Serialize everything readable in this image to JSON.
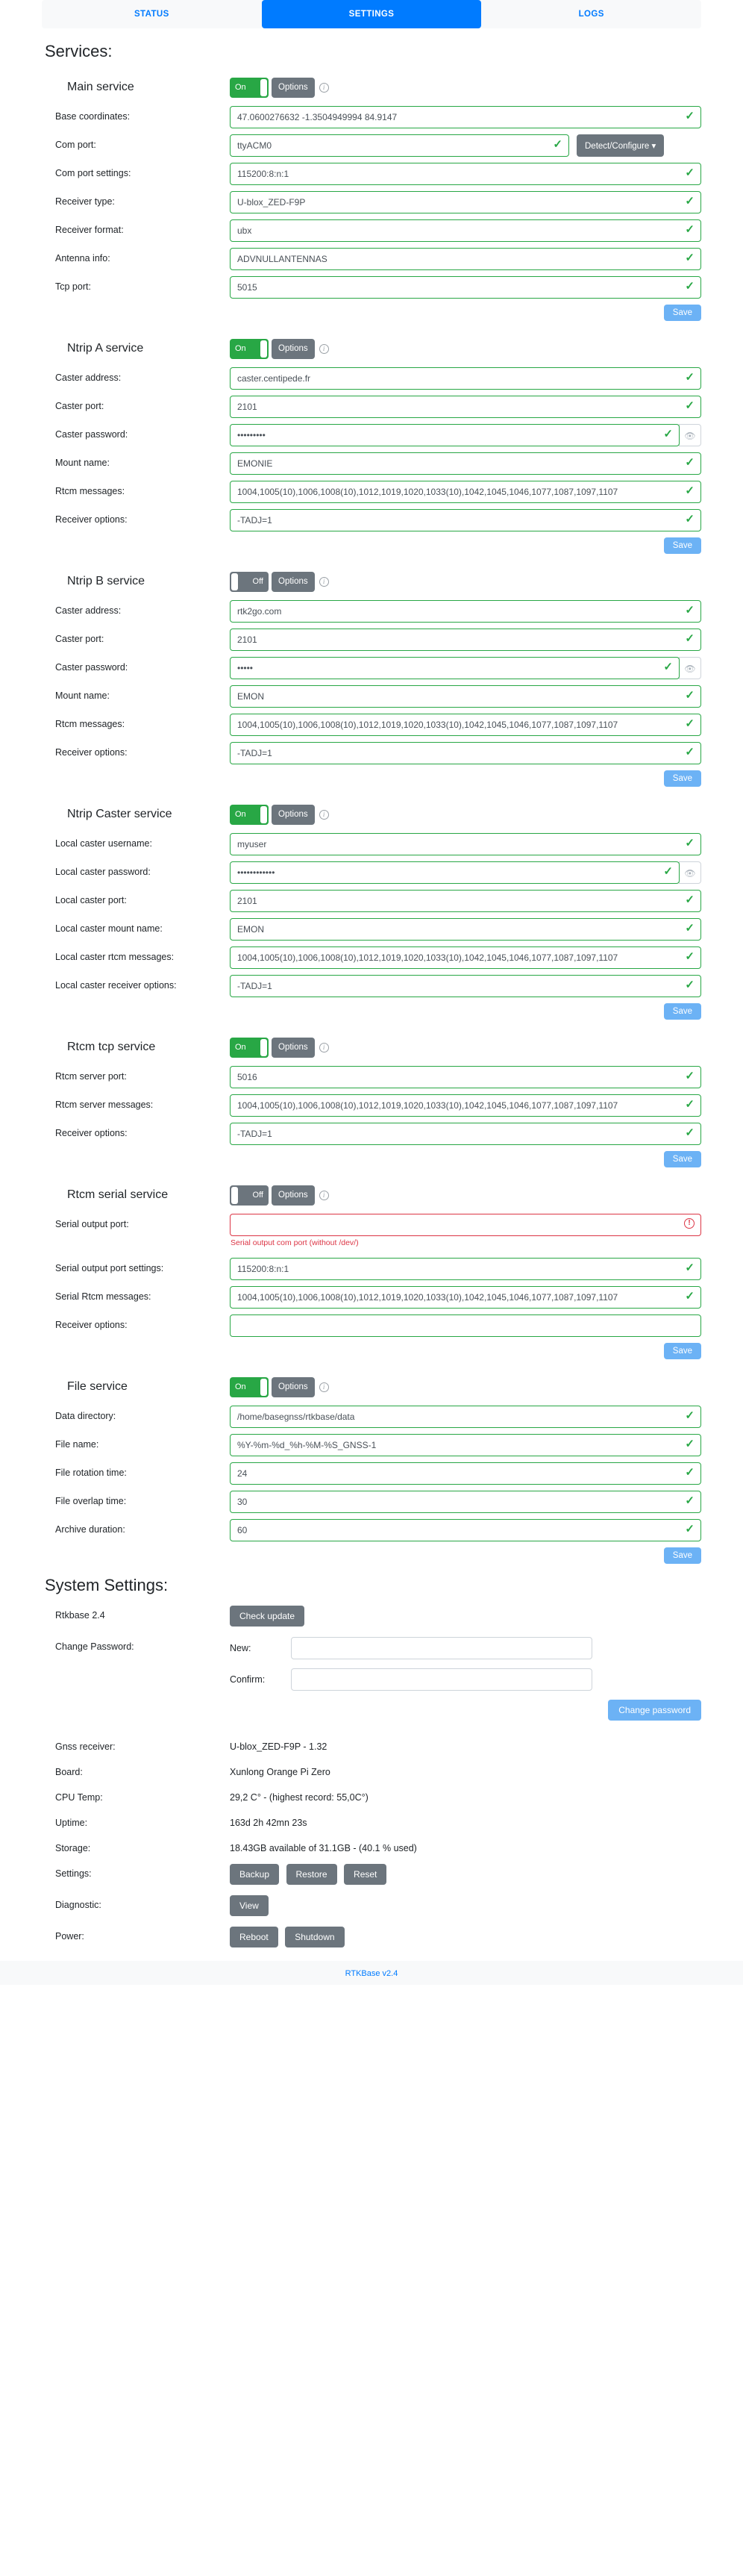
{
  "tabs": [
    {
      "label": "STATUS",
      "active": false
    },
    {
      "label": "SETTINGS",
      "active": true
    },
    {
      "label": "LOGS",
      "active": false
    }
  ],
  "headings": {
    "services": "Services:",
    "system": "System Settings:"
  },
  "common": {
    "on_label": "On",
    "off_label": "Off",
    "options_label": "Options",
    "save_label": "Save",
    "info_icon": "info-icon",
    "eye_icon": "eye-slash-icon",
    "valid_icon": "check-icon",
    "error_icon": "exclamation-icon",
    "rtcm_messages_value": "1004,1005(10),1006,1008(10),1012,1019,1020,1033(10),1042,1045,1046,1077,1087,1097,1107",
    "receiver_options_value": "-TADJ=1"
  },
  "services": {
    "main": {
      "name": "Main service",
      "state": "On",
      "fields": [
        {
          "label": "Base coordinates:",
          "value": "47.0600276632 -1.3504949994 84.9147"
        },
        {
          "label": "Com port:",
          "value": "ttyACM0"
        },
        {
          "label": "Com port settings:",
          "value": "115200:8:n:1"
        },
        {
          "label": "Receiver type:",
          "value": "U-blox_ZED-F9P"
        },
        {
          "label": "Receiver format:",
          "value": "ubx"
        },
        {
          "label": "Antenna info:",
          "value": "ADVNULLANTENNAS"
        },
        {
          "label": "Tcp port:",
          "value": "5015"
        }
      ],
      "detect_label": "Detect/Configure"
    },
    "ntrip_a": {
      "name": "Ntrip A service",
      "state": "On",
      "fields": [
        {
          "label": "Caster address:",
          "value": "caster.centipede.fr"
        },
        {
          "label": "Caster port:",
          "value": "2101"
        },
        {
          "label": "Caster password:",
          "value": "•••••••••"
        },
        {
          "label": "Mount name:",
          "value": "EMONIE"
        },
        {
          "label": "Rtcm messages:",
          "value": "1004,1005(10),1006,1008(10),1012,1019,1020,1033(10),1042,1045,1046,1077,1087,1097,1107"
        },
        {
          "label": "Receiver options:",
          "value": "-TADJ=1"
        }
      ]
    },
    "ntrip_b": {
      "name": "Ntrip B service",
      "state": "Off",
      "fields": [
        {
          "label": "Caster address:",
          "value": "rtk2go.com"
        },
        {
          "label": "Caster port:",
          "value": "2101"
        },
        {
          "label": "Caster password:",
          "value": "•••••"
        },
        {
          "label": "Mount name:",
          "value": "EMON"
        },
        {
          "label": "Rtcm messages:",
          "value": "1004,1005(10),1006,1008(10),1012,1019,1020,1033(10),1042,1045,1046,1077,1087,1097,1107"
        },
        {
          "label": "Receiver options:",
          "value": "-TADJ=1"
        }
      ]
    },
    "ntrip_caster": {
      "name": "Ntrip Caster service",
      "state": "On",
      "fields": [
        {
          "label": "Local caster username:",
          "value": "myuser"
        },
        {
          "label": "Local caster password:",
          "value": "••••••••••••"
        },
        {
          "label": "Local caster port:",
          "value": "2101"
        },
        {
          "label": "Local caster mount name:",
          "value": "EMON"
        },
        {
          "label": "Local caster rtcm messages:",
          "value": "1004,1005(10),1006,1008(10),1012,1019,1020,1033(10),1042,1045,1046,1077,1087,1097,1107"
        },
        {
          "label": "Local caster receiver options:",
          "value": "-TADJ=1"
        }
      ]
    },
    "rtcm_tcp": {
      "name": "Rtcm tcp service",
      "state": "On",
      "fields": [
        {
          "label": "Rtcm server port:",
          "value": "5016"
        },
        {
          "label": "Rtcm server messages:",
          "value": "1004,1005(10),1006,1008(10),1012,1019,1020,1033(10),1042,1045,1046,1077,1087,1097,1107"
        },
        {
          "label": "Receiver options:",
          "value": "-TADJ=1"
        }
      ]
    },
    "rtcm_serial": {
      "name": "Rtcm serial service",
      "state": "Off",
      "fields": [
        {
          "label": "Serial output port:",
          "value": "",
          "error": "Serial output com port (without /dev/)"
        },
        {
          "label": "Serial output port settings:",
          "value": "115200:8:n:1"
        },
        {
          "label": "Serial Rtcm messages:",
          "value": "1004,1005(10),1006,1008(10),1012,1019,1020,1033(10),1042,1045,1046,1077,1087,1097,1107"
        },
        {
          "label": "Receiver options:",
          "value": ""
        }
      ]
    },
    "file": {
      "name": "File service",
      "state": "On",
      "fields": [
        {
          "label": "Data directory:",
          "value": "/home/basegnss/rtkbase/data"
        },
        {
          "label": "File name:",
          "value": "%Y-%m-%d_%h-%M-%S_GNSS-1"
        },
        {
          "label": "File rotation time:",
          "value": "24"
        },
        {
          "label": "File overlap time:",
          "value": "30"
        },
        {
          "label": "Archive duration:",
          "value": "60"
        }
      ]
    }
  },
  "system": {
    "version_label": "Rtkbase 2.4",
    "check_update_label": "Check update",
    "change_password_label": "Change Password:",
    "new_label": "New:",
    "new_value": "",
    "confirm_label": "Confirm:",
    "confirm_value": "",
    "change_password_btn": "Change password",
    "info": [
      {
        "label": "Gnss receiver:",
        "value": "U-blox_ZED-F9P - 1.32"
      },
      {
        "label": "Board:",
        "value": "Xunlong Orange Pi Zero"
      },
      {
        "label": "CPU Temp:",
        "value": "29,2 C° - (highest record: 55,0C°)"
      },
      {
        "label": "Uptime:",
        "value": "163d 2h 42mn 23s"
      },
      {
        "label": "Storage:",
        "value": "18.43GB available of 31.1GB - (40.1 % used)"
      }
    ],
    "settings_label": "Settings:",
    "settings_buttons": [
      "Backup",
      "Restore",
      "Reset"
    ],
    "diagnostic_label": "Diagnostic:",
    "diagnostic_buttons": [
      "View"
    ],
    "power_label": "Power:",
    "power_buttons": [
      "Reboot",
      "Shutdown"
    ]
  },
  "footer": {
    "text": "RTKBase v2.4"
  }
}
